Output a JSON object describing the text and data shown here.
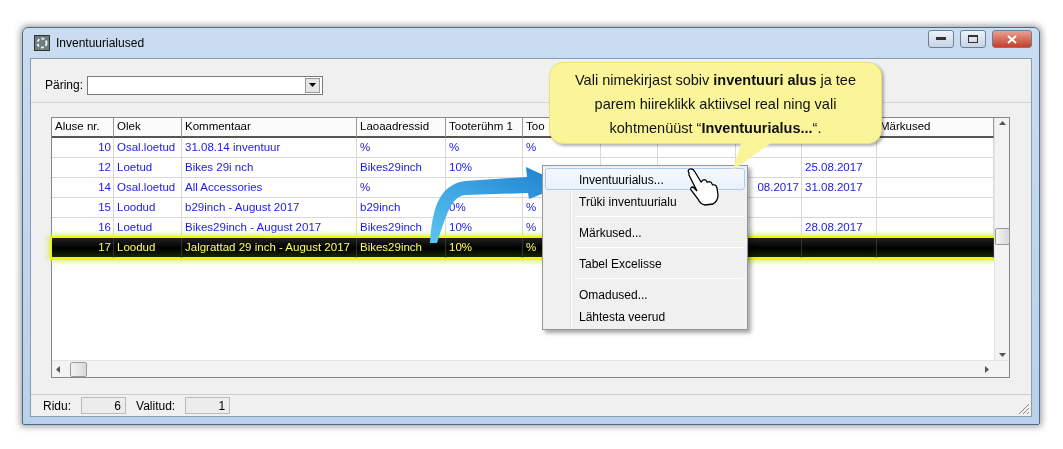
{
  "window": {
    "title": "Inventuurialused"
  },
  "query": {
    "label": "Päring:"
  },
  "table": {
    "columns": [
      {
        "label": "Aluse nr."
      },
      {
        "label": "Olek"
      },
      {
        "label": "Kommentaar"
      },
      {
        "label": "Laoaadressid"
      },
      {
        "label": "Tooterühm 1"
      },
      {
        "label": "Too"
      },
      {},
      {},
      {},
      {},
      {
        "label": "Märkused"
      }
    ],
    "rows": [
      {
        "selected": false,
        "cells": [
          "10",
          "Osal.loetud",
          "31.08.14 inventuur",
          "%",
          "%",
          "%",
          null,
          null,
          null,
          null,
          null
        ]
      },
      {
        "selected": false,
        "cells": [
          "12",
          "Loetud",
          "Bikes 29i nch",
          "Bikes29inch",
          "10%",
          null,
          null,
          null,
          null,
          "25.08.2017",
          null
        ]
      },
      {
        "selected": false,
        "cells": [
          "14",
          "Osal.loetud",
          "All Accessories",
          "%",
          null,
          null,
          null,
          null,
          "08.2017",
          "31.08.2017",
          null
        ]
      },
      {
        "selected": false,
        "cells": [
          "15",
          "Loodud",
          "b29inch - August 2017",
          "b29inch",
          "0%",
          "%",
          null,
          null,
          null,
          null,
          null
        ]
      },
      {
        "selected": false,
        "cells": [
          "16",
          "Loetud",
          "Bikes29inch - August 2017",
          "Bikes29inch",
          "10%",
          "%",
          null,
          null,
          null,
          "28.08.2017",
          null
        ]
      },
      {
        "selected": true,
        "cells": [
          "17",
          "Loodud",
          "Jalgrattad 29 inch - August 2017",
          "Bikes29inch",
          "10%",
          "%",
          null,
          null,
          null,
          null,
          null
        ]
      }
    ]
  },
  "status": [
    {
      "label": "Ridu:",
      "value": "6"
    },
    {
      "label": "Valitud:",
      "value": "1"
    }
  ],
  "callout": {
    "text": "Vali nimekirjast sobiv **inventuuri alus** ja tee parem hiireklikk aktiivsel real ning vali kohtmenüüst “**Inventuurialus...**“."
  },
  "context_menu": {
    "groups": [
      [
        {
          "label": "Inventuurialus...",
          "selected": true
        },
        {
          "label": "Trüki inventuurialu",
          "selected": false
        }
      ],
      [
        {
          "label": "Märkused...",
          "selected": false
        }
      ],
      [
        {
          "label": "Tabel Excelisse",
          "selected": false
        }
      ],
      [
        {
          "label": "Omadused...",
          "selected": false
        },
        {
          "label": "Lähtesta veerud",
          "selected": false
        }
      ]
    ]
  }
}
